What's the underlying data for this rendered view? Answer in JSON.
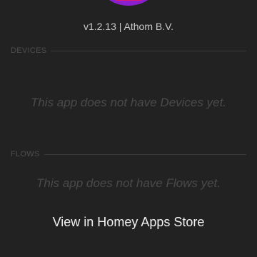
{
  "app": {
    "icon": "homey-app-icon",
    "version_line": "v1.2.13 | Athom B.V."
  },
  "devices_section": {
    "header": "DEVICES",
    "empty_message": "This app does not have Devices yet."
  },
  "flows_section": {
    "header": "FLOWS",
    "empty_message": "This app does not have Flows yet."
  },
  "store_link": {
    "label": "View in Homey Apps Store"
  },
  "colors": {
    "background": "#222222",
    "icon_purple": "#8a1fd0",
    "icon_accent": "#e01b6e"
  }
}
